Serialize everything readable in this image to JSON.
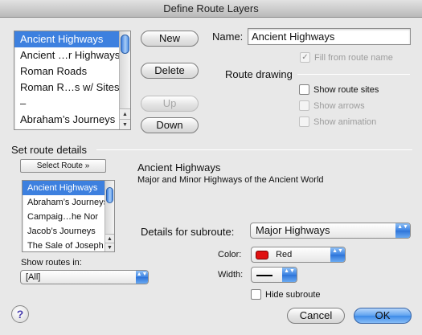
{
  "window": {
    "title": "Define Route Layers"
  },
  "layers_list": {
    "items": [
      {
        "label": "Ancient Highways",
        "selected": true
      },
      {
        "label": "Ancient …r Highways",
        "selected": false
      },
      {
        "label": "Roman Roads",
        "selected": false
      },
      {
        "label": "Roman R…s w/ Sites",
        "selected": false
      },
      {
        "label": "–",
        "selected": false
      },
      {
        "label": "Abraham’s Journeys",
        "selected": false
      }
    ]
  },
  "buttons": {
    "new": "New",
    "delete": "Delete",
    "up": "Up",
    "down": "Down",
    "select_route": "Select Route »",
    "cancel": "Cancel",
    "ok": "OK",
    "help": "?"
  },
  "name_field": {
    "label": "Name:",
    "value": "Ancient Highways"
  },
  "fill_from_route_name": {
    "label": "Fill from route name",
    "checked": true,
    "enabled": false
  },
  "route_drawing": {
    "heading": "Route drawing",
    "show_route_sites": {
      "label": "Show route sites",
      "checked": false
    },
    "show_arrows": {
      "label": "Show arrows",
      "checked": false,
      "enabled": false
    },
    "show_animation": {
      "label": "Show animation",
      "checked": false,
      "enabled": false
    }
  },
  "route_details": {
    "heading": "Set route details",
    "route_title": "Ancient Highways",
    "route_description": "Major and Minor Highways of the Ancient World"
  },
  "routes_list": {
    "items": [
      {
        "label": "Ancient Highways",
        "selected": true
      },
      {
        "label": "Abraham’s Journeys",
        "selected": false
      },
      {
        "label": "Campaig…he Nor",
        "selected": false
      },
      {
        "label": "Jacob’s Journeys",
        "selected": false
      },
      {
        "label": "The Sale of Joseph",
        "selected": false
      }
    ]
  },
  "show_routes_in": {
    "label": "Show routes in:",
    "value": "[All]"
  },
  "subroute": {
    "label": "Details for subroute:",
    "value": "Major Highways"
  },
  "color": {
    "label": "Color:",
    "value": "Red",
    "swatch": "#e01010"
  },
  "width": {
    "label": "Width:"
  },
  "hide_subroute": {
    "label": "Hide subroute",
    "checked": false
  },
  "icons": {
    "scroll_up": "▲",
    "scroll_down": "▼",
    "popup_arrows": "▲▼",
    "check": "✓"
  }
}
